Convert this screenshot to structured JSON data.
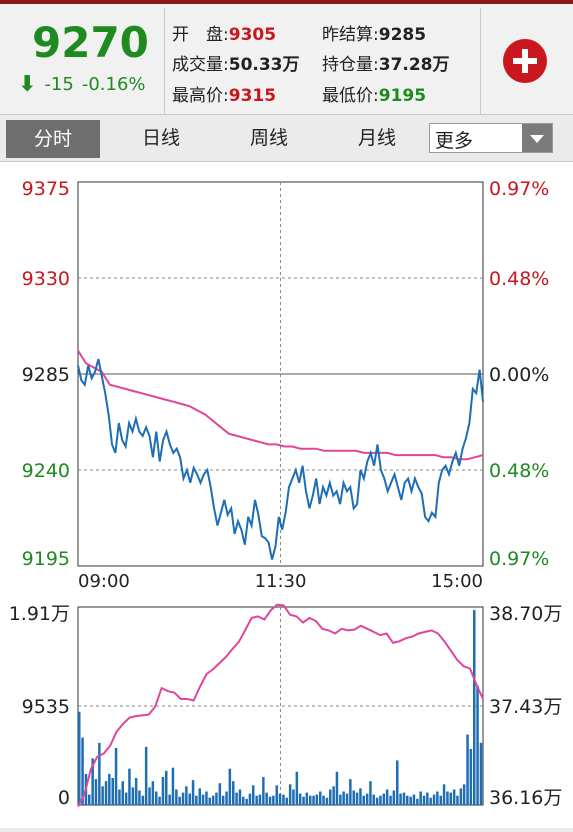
{
  "quote": {
    "price": "9270",
    "change": "-15",
    "change_pct": "-0.16%",
    "open_label": "开　盘:",
    "open": "9305",
    "prev_settle_label": "昨结算:",
    "prev_settle": "9285",
    "volume_label": "成交量:",
    "volume": "50.33万",
    "open_interest_label": "持仓量:",
    "open_interest": "37.28万",
    "high_label": "最高价:",
    "high": "9315",
    "low_label": "最低价:",
    "low": "9195"
  },
  "tabs": [
    "分时",
    "日线",
    "周线",
    "月线"
  ],
  "more_dropdown": "更多",
  "colors": {
    "up": "#c8171e",
    "down": "#1f8a1f",
    "price_line": "#1e6eb5",
    "avg_line": "#e0459c",
    "volume": "#1e6eb5",
    "open_interest": "#e0459c"
  },
  "chart_data": [
    {
      "type": "line",
      "title": "",
      "x_ticks": [
        "09:00",
        "11:30",
        "15:00"
      ],
      "ylim": [
        9195,
        9375
      ],
      "y_ticks_left": [
        "9375",
        "9330",
        "9285",
        "9240",
        "9195"
      ],
      "y_ticks_right": [
        "0.97%",
        "0.48%",
        "0.00%",
        "0.48%",
        "0.97%"
      ],
      "baseline": 9285,
      "series": [
        {
          "values": [
            9289,
            9282,
            9280,
            9289,
            9283,
            9286,
            9292,
            9284,
            9276,
            9266,
            9252,
            9248,
            9262,
            9254,
            9251,
            9262,
            9258,
            9264,
            9258,
            9256,
            9260,
            9256,
            9246,
            9258,
            9244,
            9254,
            9258,
            9252,
            9248,
            9250,
            9246,
            9236,
            9240,
            9234,
            9241,
            9238,
            9234,
            9238,
            9240,
            9232,
            9222,
            9214,
            9220,
            9226,
            9219,
            9222,
            9210,
            9216,
            9212,
            9205,
            9218,
            9214,
            9226,
            9219,
            9209,
            9208,
            9206,
            9198,
            9204,
            9218,
            9212,
            9220,
            9232,
            9236,
            9240,
            9234,
            9242,
            9230,
            9222,
            9228,
            9236,
            9224,
            9232,
            9228,
            9234,
            9228,
            9230,
            9224,
            9234,
            9230,
            9232,
            9222,
            9224,
            9240,
            9236,
            9244,
            9248,
            9242,
            9252,
            9240,
            9236,
            9230,
            9234,
            9238,
            9232,
            9226,
            9234,
            9236,
            9230,
            9236,
            9232,
            9229,
            9218,
            9216,
            9220,
            9218,
            9234,
            9240,
            9242,
            9238,
            9244,
            9248,
            9242,
            9250,
            9255,
            9262,
            9278,
            9276,
            9287,
            9272
          ]
        },
        {
          "values": [
            9296,
            9290,
            9288,
            9286,
            9280,
            9279,
            9278,
            9277,
            9276,
            9275,
            9274,
            9273,
            9272,
            9271,
            9270,
            9268,
            9266,
            9263,
            9260,
            9257,
            9256,
            9255,
            9254,
            9253,
            9252,
            9252,
            9251,
            9251,
            9250,
            9250,
            9250,
            9249,
            9249,
            9249,
            9249,
            9249,
            9248,
            9248,
            9248,
            9248,
            9247,
            9247,
            9247,
            9247,
            9247,
            9247,
            9246,
            9246,
            9245,
            9245,
            9246,
            9247
          ]
        }
      ]
    },
    {
      "type": "bar",
      "title": "",
      "x_ticks": [
        "09:00",
        "11:30",
        "15:00"
      ],
      "ylim": [
        0,
        19100
      ],
      "y_ticks_left": [
        "1.91万",
        "9535",
        "0"
      ],
      "y_ticks_right": [
        "38.70万",
        "37.43万",
        "36.16万"
      ],
      "series": [
        {
          "name": "成交量",
          "values": [
            9000,
            6500,
            3000,
            1000,
            4500,
            2500,
            6000,
            1800,
            2300,
            3000,
            2600,
            5500,
            1500,
            2300,
            1200,
            3500,
            1700,
            2600,
            1400,
            900,
            5600,
            1700,
            2300,
            1300,
            800,
            2700,
            3300,
            1000,
            3600,
            1500,
            800,
            1200,
            1800,
            1100,
            2400,
            900,
            1600,
            1000,
            1300,
            700,
            900,
            1200,
            2100,
            900,
            1300,
            3500,
            2300,
            1200,
            1500,
            800,
            600,
            1100,
            1900,
            900,
            1000,
            2700,
            1200,
            800,
            900,
            1900,
            1100,
            1000,
            700,
            2000,
            1500,
            3200,
            1100,
            800,
            1200,
            900,
            900,
            1000,
            1300,
            900,
            700,
            1500,
            1800,
            3200,
            1000,
            1300,
            1100,
            2500,
            1400,
            1200,
            1600,
            900,
            1100,
            2300,
            1000,
            700,
            900,
            1100,
            1500,
            900,
            1400,
            4300,
            1100,
            1200,
            900,
            800,
            1000,
            600,
            1300,
            900,
            1200,
            700,
            1000,
            1300,
            900,
            2000,
            1300,
            1200,
            1500,
            900,
            1600,
            2000,
            6800,
            5400,
            18800,
            11500,
            6000
          ]
        },
        {
          "name": "持仓量",
          "values": [
            36.14,
            36.3,
            36.62,
            36.78,
            36.82,
            36.92,
            37.1,
            37.2,
            37.28,
            37.3,
            37.31,
            37.32,
            37.42,
            37.66,
            37.62,
            37.6,
            37.52,
            37.52,
            37.5,
            37.68,
            37.84,
            37.9,
            37.98,
            38.06,
            38.16,
            38.25,
            38.4,
            38.56,
            38.58,
            38.54,
            38.66,
            38.73,
            38.72,
            38.6,
            38.58,
            38.5,
            38.56,
            38.52,
            38.42,
            38.4,
            38.36,
            38.42,
            38.4,
            38.41,
            38.46,
            38.42,
            38.38,
            38.34,
            38.36,
            38.24,
            38.26,
            38.3,
            38.32,
            38.36,
            38.38,
            38.4,
            38.36,
            38.26,
            38.14,
            38.02,
            37.94,
            37.91,
            37.7,
            37.52
          ]
        }
      ]
    }
  ]
}
